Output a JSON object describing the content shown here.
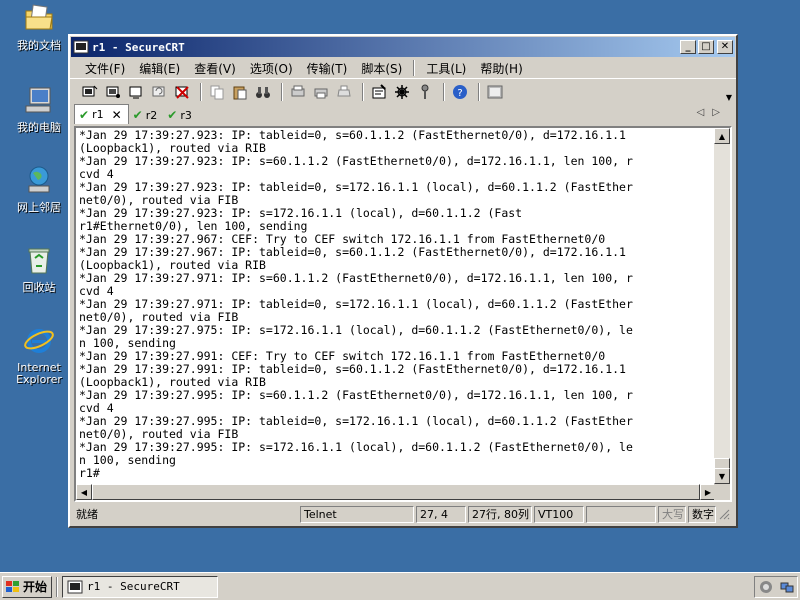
{
  "desktop": {
    "icons": [
      {
        "label": "我的文档",
        "icon": "documents-folder-icon"
      },
      {
        "label": "我的电脑",
        "icon": "computer-icon"
      },
      {
        "label": "网上邻居",
        "icon": "network-icon"
      },
      {
        "label": "回收站",
        "icon": "recycle-bin-icon"
      },
      {
        "label": "Internet Explorer",
        "icon": "ie-icon"
      }
    ]
  },
  "window": {
    "title": "r1 - SecureCRT",
    "menu": [
      "文件(F)",
      "编辑(E)",
      "查看(V)",
      "选项(O)",
      "传输(T)",
      "脚本(S)",
      "工具(L)",
      "帮助(H)"
    ],
    "tabs": [
      {
        "label": "r1",
        "active": true
      },
      {
        "label": "r2",
        "active": false
      },
      {
        "label": "r3",
        "active": false
      }
    ],
    "terminal_lines": [
      "*Jan 29 17:39:27.923: IP: tableid=0, s=60.1.1.2 (FastEthernet0/0), d=172.16.1.1",
      "(Loopback1), routed via RIB",
      "*Jan 29 17:39:27.923: IP: s=60.1.1.2 (FastEthernet0/0), d=172.16.1.1, len 100, r",
      "cvd 4",
      "*Jan 29 17:39:27.923: IP: tableid=0, s=172.16.1.1 (local), d=60.1.1.2 (FastEther",
      "net0/0), routed via FIB",
      "*Jan 29 17:39:27.923: IP: s=172.16.1.1 (local), d=60.1.1.2 (Fast",
      "r1#Ethernet0/0), len 100, sending",
      "*Jan 29 17:39:27.967: CEF: Try to CEF switch 172.16.1.1 from FastEthernet0/0",
      "*Jan 29 17:39:27.967: IP: tableid=0, s=60.1.1.2 (FastEthernet0/0), d=172.16.1.1",
      "(Loopback1), routed via RIB",
      "*Jan 29 17:39:27.971: IP: s=60.1.1.2 (FastEthernet0/0), d=172.16.1.1, len 100, r",
      "cvd 4",
      "*Jan 29 17:39:27.971: IP: tableid=0, s=172.16.1.1 (local), d=60.1.1.2 (FastEther",
      "net0/0), routed via FIB",
      "*Jan 29 17:39:27.975: IP: s=172.16.1.1 (local), d=60.1.1.2 (FastEthernet0/0), le",
      "n 100, sending",
      "*Jan 29 17:39:27.991: CEF: Try to CEF switch 172.16.1.1 from FastEthernet0/0",
      "*Jan 29 17:39:27.991: IP: tableid=0, s=60.1.1.2 (FastEthernet0/0), d=172.16.1.1",
      "(Loopback1), routed via RIB",
      "*Jan 29 17:39:27.995: IP: s=60.1.1.2 (FastEthernet0/0), d=172.16.1.1, len 100, r",
      "cvd 4",
      "*Jan 29 17:39:27.995: IP: tableid=0, s=172.16.1.1 (local), d=60.1.1.2 (FastEther",
      "net0/0), routed via FIB",
      "*Jan 29 17:39:27.995: IP: s=172.16.1.1 (local), d=60.1.1.2 (FastEthernet0/0), le",
      "n 100, sending",
      "r1#"
    ],
    "status": {
      "ready": "就绪",
      "protocol": "Telnet",
      "cursor": "27,  4",
      "size": "27行, 80列",
      "emulation": "VT100",
      "caps": "大写",
      "num": "数字"
    }
  },
  "taskbar": {
    "start": "开始",
    "task": "r1 - SecureCRT"
  },
  "colors": {
    "desktop": "#3a6ea5",
    "title_start": "#0a246a",
    "title_end": "#a6caf0"
  }
}
